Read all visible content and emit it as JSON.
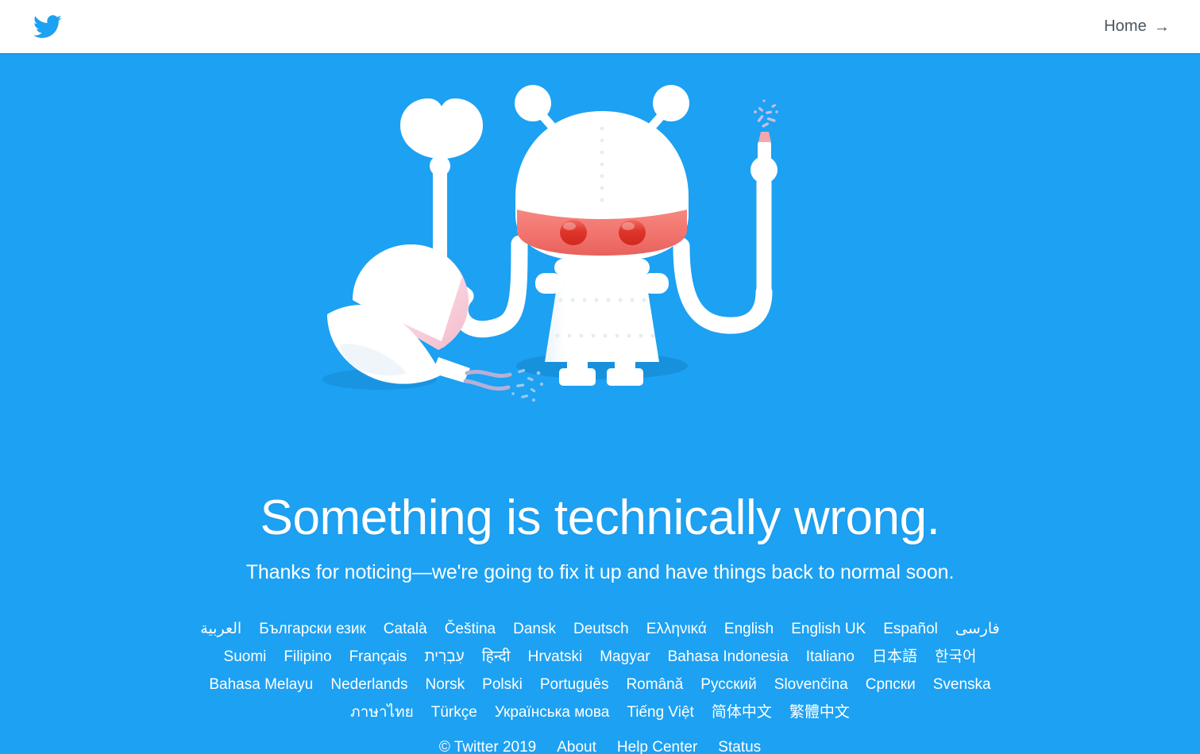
{
  "theme": {
    "background": "#1DA1F2",
    "header_background": "#FFFFFF",
    "text_on_blue": "#FFFFFF",
    "header_link_color": "#4A5560",
    "brand_blue": "#1DA1F2",
    "accent_red": "#F2736D",
    "accent_red_dark": "#E0352B",
    "shadow_blue": "#1485CC",
    "robot_white": "#FFFFFF",
    "robot_pink": "#F7C9D4",
    "wire_lavender": "#B7AFD6"
  },
  "header": {
    "logo_name": "twitter-bird-logo",
    "home_label": "Home",
    "home_arrow": "→"
  },
  "illustration": {
    "name": "broken-robot-illustration",
    "description": "White robot with red visor, antennae, claw arm and sparking arm, beside a cracked white sphere"
  },
  "message": {
    "headline": "Something is technically wrong.",
    "subhead": "Thanks for noticing—we're going to fix it up and have things back to normal soon."
  },
  "languages": {
    "rows": [
      [
        "العربية",
        "Български език",
        "Català",
        "Čeština",
        "Dansk",
        "Deutsch",
        "Ελληνικά",
        "English",
        "English UK",
        "Español",
        "فارسی"
      ],
      [
        "Suomi",
        "Filipino",
        "Français",
        "עִבְרִית",
        "हिन्दी",
        "Hrvatski",
        "Magyar",
        "Bahasa Indonesia",
        "Italiano",
        "日本語",
        "한국어"
      ],
      [
        "Bahasa Melayu",
        "Nederlands",
        "Norsk",
        "Polski",
        "Português",
        "Română",
        "Русский",
        "Slovenčina",
        "Српски",
        "Svenska"
      ],
      [
        "ภาษาไทย",
        "Türkçe",
        "Українська мова",
        "Tiếng Việt",
        "简体中文",
        "繁體中文"
      ]
    ]
  },
  "footer": {
    "copyright": "© Twitter 2019",
    "links": [
      "About",
      "Help Center",
      "Status"
    ]
  }
}
